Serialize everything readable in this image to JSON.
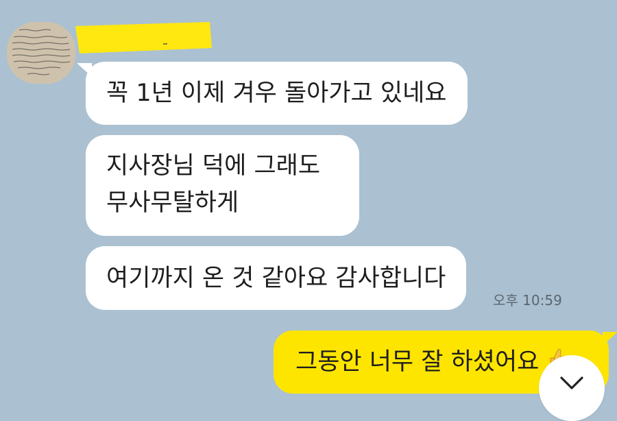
{
  "chat": {
    "incoming": {
      "avatar": "handwritten-letter-photo",
      "sender_name_redacted": true,
      "messages": [
        {
          "lines": [
            "꼭 1년 이제 겨우 돌아가고 있네요"
          ]
        },
        {
          "lines": [
            "지사장님 덕에 그래도",
            "무사무탈하게"
          ]
        },
        {
          "lines": [
            "여기까지 온 것 같아요 감사합니다"
          ]
        }
      ],
      "time": "오후 10:59"
    },
    "outgoing": {
      "messages": [
        {
          "text": "그동안 너무 잘 하셨어요",
          "emoji": "thumbs-up-icon"
        }
      ]
    }
  },
  "controls": {
    "scroll_down_icon": "chevron-down-icon"
  },
  "colors": {
    "background": "#abc1d1",
    "incoming_bubble": "#ffffff",
    "outgoing_bubble": "#fee500",
    "redaction_highlight": "#ffe810",
    "timestamp_text": "#5b6670"
  }
}
